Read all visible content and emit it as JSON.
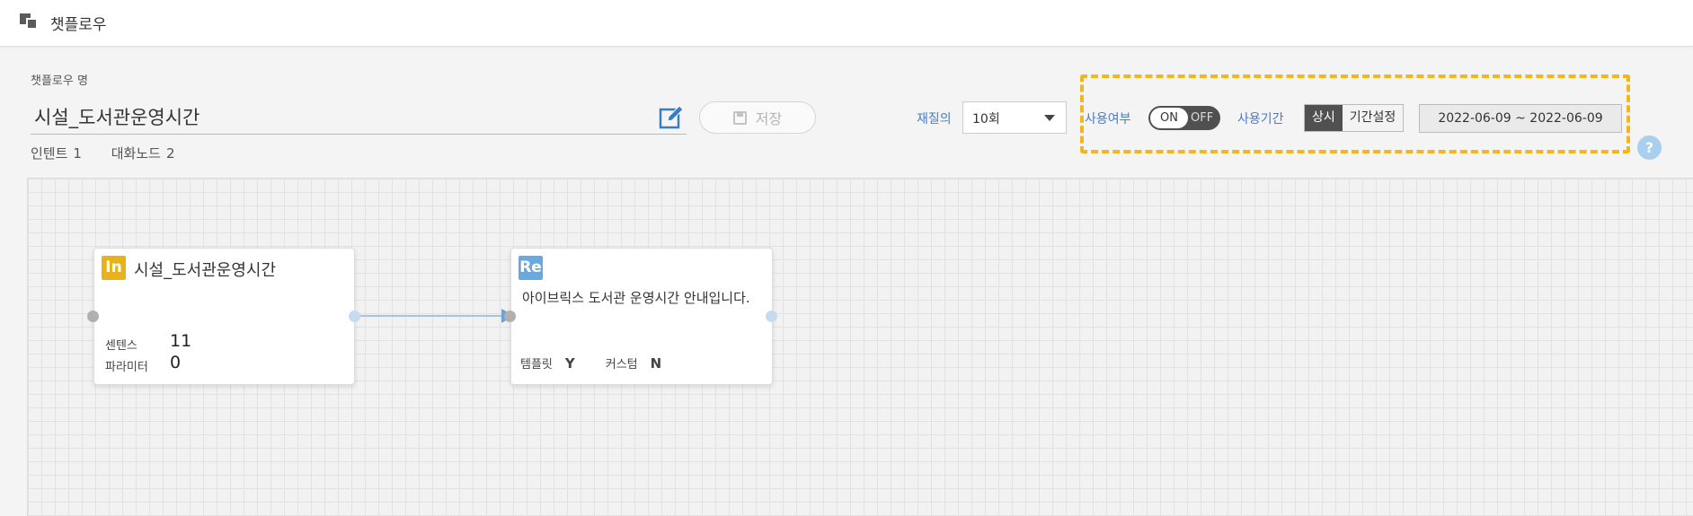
{
  "header": {
    "title": "챗플로우"
  },
  "form": {
    "name_label": "챗플로우 명",
    "name_value": "시설_도서관운영시간",
    "save_label": "저장",
    "intent_label": "인텐트",
    "intent_count": "1",
    "node_label": "대화노드",
    "node_count": "2"
  },
  "retry": {
    "label": "재질의",
    "value": "10회"
  },
  "usage": {
    "label": "사용여부",
    "on_label": "ON",
    "off_label": "OFF",
    "period_label": "사용기간",
    "period_always": "상시",
    "period_custom": "기간설정",
    "date_range": "2022-06-09 ~ 2022-06-09",
    "help": "?"
  },
  "nodes": {
    "intent": {
      "badge": "In",
      "title": "시설_도서관운영시간",
      "sentence_label": "센텐스",
      "sentence_value": "11",
      "param_label": "파라미터",
      "param_value": "0"
    },
    "response": {
      "badge": "Re",
      "text": "아이브릭스 도서관 운영시간 안내입니다.",
      "template_label": "템플릿",
      "template_value": "Y",
      "custom_label": "커스텀",
      "custom_value": "N"
    }
  },
  "colors": {
    "accent": "#f3b61c",
    "intent_badge": "#e8b21b",
    "response_badge": "#6aa9e0",
    "link": "#4a7cc0"
  }
}
